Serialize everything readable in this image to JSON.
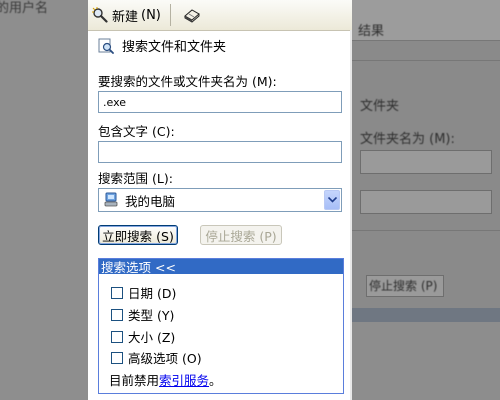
{
  "background": {
    "left_fragment": "的用户名",
    "right_fragments": [
      "结果",
      "文件夹",
      "文件夹名为 (M):",
      "停止搜索 (P)"
    ]
  },
  "toolbar": {
    "new_label": "新建",
    "new_accel": "(N)"
  },
  "panel": {
    "title": "搜索文件和文件夹"
  },
  "name_field": {
    "label": "要搜索的文件或文件夹名为 (M):",
    "value": ".exe"
  },
  "text_field": {
    "label": "包含文字 (C):",
    "value": ""
  },
  "scope": {
    "label": "搜索范围 (L):",
    "selected": "我的电脑"
  },
  "buttons": {
    "search": "立即搜索 (S)",
    "stop": "停止搜索 (P)"
  },
  "options": {
    "header": "搜索选项 <<",
    "items": [
      {
        "label": "日期 (D)"
      },
      {
        "label": "类型 (Y)"
      },
      {
        "label": "大小 (Z)"
      },
      {
        "label": "高级选项 (O)"
      }
    ],
    "footer_prefix": "目前禁用",
    "footer_link": "索引服务",
    "footer_suffix": "。"
  },
  "colors": {
    "accent": "#316ac5",
    "link": "#0000ee",
    "field_border": "#7f9db9"
  }
}
